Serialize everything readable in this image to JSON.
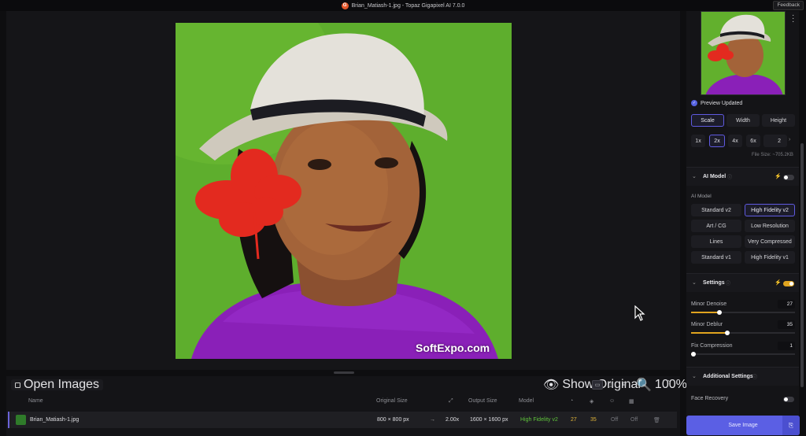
{
  "window": {
    "title": "Brian_Matiash-1.jpg - Topaz Gigapixel AI 7.0.0",
    "feedback_label": "Feedback"
  },
  "canvas": {
    "watermark": "SoftExpo.com"
  },
  "bottom": {
    "open_images": "Open Images",
    "show_original": "Show Original",
    "zoom": "100%",
    "headers": {
      "name": "Name",
      "original_size": "Original Size",
      "output_size": "Output Size",
      "model": "Model"
    },
    "row": {
      "name": "Brian_Matiash-1.jpg",
      "original_size": "800 × 800 px",
      "scale": "2.00x",
      "output_size": "1600 × 1600 px",
      "model": "High Fidelity v2",
      "denoise": "27",
      "deblur": "35",
      "face": "Off",
      "compress": "Off"
    }
  },
  "sidebar": {
    "preview_status": "Preview Updated",
    "size_tabs": [
      "Scale",
      "Width",
      "Height"
    ],
    "scale_options": [
      "1x",
      "2x",
      "4x",
      "6x"
    ],
    "custom_scale": "2",
    "file_size": "File Size: ~705.2KB",
    "ai_model_section": "AI Model",
    "ai_model_label": "AI Model",
    "models": [
      "Standard v2",
      "High Fidelity v2",
      "Art / CG",
      "Low Resolution",
      "Lines",
      "Very Compressed",
      "Standard v1",
      "High Fidelity v1"
    ],
    "settings_section": "Settings",
    "minor_denoise_label": "Minor Denoise",
    "minor_denoise": 27,
    "minor_deblur_label": "Minor Deblur",
    "minor_deblur": 35,
    "fix_compression_label": "Fix Compression",
    "fix_compression": 1,
    "additional_section": "Additional Settings",
    "face_recovery_label": "Face Recovery",
    "save_label": "Save Image"
  },
  "colors": {
    "accent": "#5b5fe4",
    "slider": "#e0a41f",
    "model_green": "#5fc33b",
    "value_yellow": "#e0b43a"
  }
}
